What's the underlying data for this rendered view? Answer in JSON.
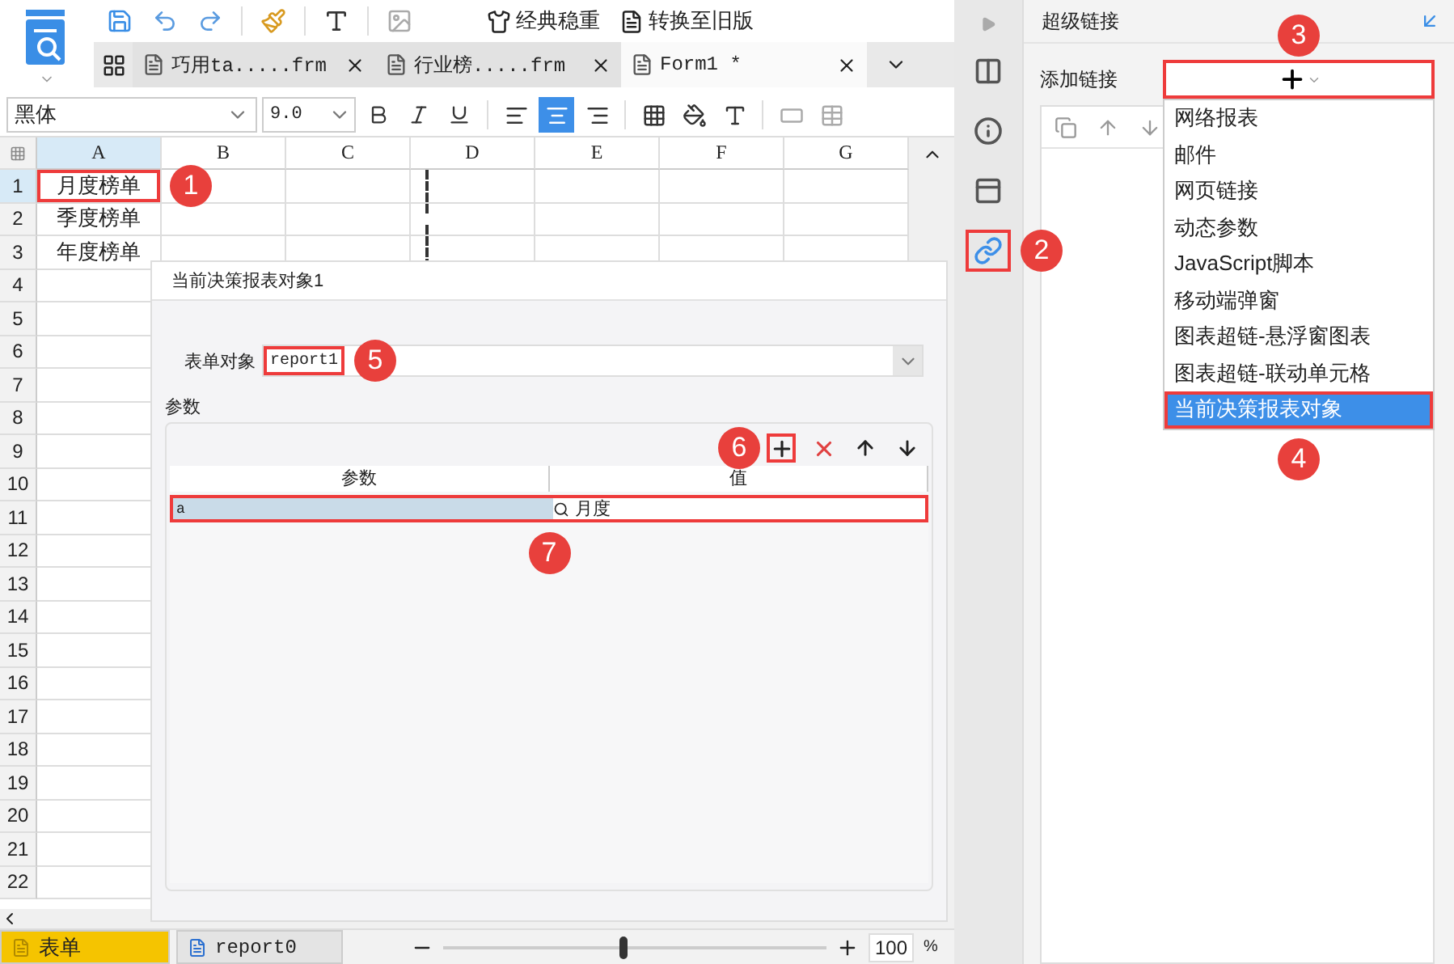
{
  "toolbar": {
    "buttons": [
      {
        "kind": "theme",
        "label": "经典稳重"
      },
      {
        "kind": "convert",
        "label": "转换至旧版"
      }
    ]
  },
  "tabs": [
    {
      "label": "巧用ta.....frm",
      "selected": false
    },
    {
      "label": "行业榜.....frm",
      "selected": false
    },
    {
      "label": "Form1 *",
      "selected": true
    }
  ],
  "format_bar": {
    "font": "黑体",
    "size": "9.0",
    "align": [
      {
        "kind": "left",
        "selected": false
      },
      {
        "kind": "center",
        "selected": true
      },
      {
        "kind": "right",
        "selected": false
      }
    ]
  },
  "sheet": {
    "columns": [
      {
        "label": "A",
        "selected": true
      },
      {
        "label": "B",
        "selected": false
      },
      {
        "label": "C",
        "selected": false
      },
      {
        "label": "D",
        "selected": false
      },
      {
        "label": "E",
        "selected": false
      },
      {
        "label": "F",
        "selected": false
      },
      {
        "label": "G",
        "selected": false
      }
    ],
    "rows": [
      {
        "number": "1",
        "value": "月度榜单",
        "selected": true,
        "callout": "1"
      },
      {
        "number": "2",
        "value": "季度榜单",
        "selected": false
      },
      {
        "number": "3",
        "value": "年度榜单",
        "selected": false
      },
      {
        "number": "4",
        "selected": false
      },
      {
        "number": "5",
        "selected": false
      },
      {
        "number": "6",
        "selected": false
      },
      {
        "number": "7",
        "selected": false
      },
      {
        "number": "8",
        "selected": false
      },
      {
        "number": "9",
        "selected": false
      },
      {
        "number": "10",
        "selected": false
      },
      {
        "number": "11",
        "selected": false
      },
      {
        "number": "12",
        "selected": false
      },
      {
        "number": "13",
        "selected": false
      },
      {
        "number": "14",
        "selected": false
      },
      {
        "number": "15",
        "selected": false
      },
      {
        "number": "16",
        "selected": false
      },
      {
        "number": "17",
        "selected": false
      },
      {
        "number": "18",
        "selected": false
      },
      {
        "number": "19",
        "selected": false
      },
      {
        "number": "20",
        "selected": false
      },
      {
        "number": "21",
        "selected": false
      },
      {
        "number": "22",
        "selected": false
      }
    ]
  },
  "dialog": {
    "title": "当前决策报表对象1",
    "form_object": {
      "label": "表单对象",
      "value": "report1",
      "callout": "5"
    },
    "params": {
      "title": "参数",
      "add_callout": "6",
      "columns": [
        "参数",
        "值"
      ],
      "rows": [
        {
          "name": "a",
          "value": "月度",
          "selected": true,
          "callout": "7"
        }
      ]
    }
  },
  "bottom_bar": {
    "sheets": [
      {
        "label": "表单",
        "selected": true
      },
      {
        "label": "report0",
        "selected": false
      }
    ],
    "zoom": {
      "level": 0.47,
      "value": "100",
      "unit": "%"
    }
  },
  "side_strip": {
    "items": [
      {
        "kind": "layout",
        "selected": false
      },
      {
        "kind": "info",
        "selected": false
      },
      {
        "kind": "widget",
        "selected": false
      },
      {
        "kind": "link",
        "selected": true,
        "callout": "2"
      }
    ]
  },
  "hyperlink_panel": {
    "title": "超级链接",
    "add_label": "添加链接",
    "add_callout": "3",
    "menu": [
      {
        "label": "网络报表",
        "selected": false
      },
      {
        "label": "邮件",
        "selected": false
      },
      {
        "label": "网页链接",
        "selected": false
      },
      {
        "label": "动态参数",
        "selected": false
      },
      {
        "label": "JavaScript脚本",
        "selected": false
      },
      {
        "label": "移动端弹窗",
        "selected": false
      },
      {
        "label": "图表超链-悬浮窗图表",
        "selected": false
      },
      {
        "label": "图表超链-联动单元格",
        "selected": false
      },
      {
        "label": "当前决策报表对象",
        "selected": true,
        "callout": "4"
      }
    ]
  }
}
